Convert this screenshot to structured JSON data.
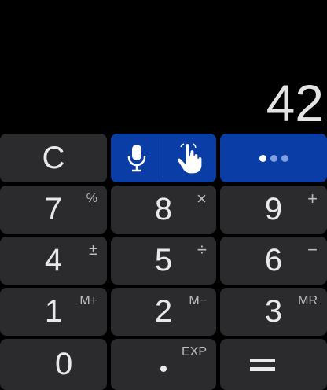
{
  "display": {
    "value": "42"
  },
  "keys": {
    "clear": "C",
    "row1": [
      {
        "main": "7",
        "sec": "%"
      },
      {
        "main": "8",
        "sec": "×"
      },
      {
        "main": "9",
        "sec": "+"
      }
    ],
    "row2": [
      {
        "main": "4",
        "sec": "±"
      },
      {
        "main": "5",
        "sec": "÷"
      },
      {
        "main": "6",
        "sec": "−"
      }
    ],
    "row3": [
      {
        "main": "1",
        "sec": "M+"
      },
      {
        "main": "2",
        "sec": "M−"
      },
      {
        "main": "3",
        "sec": "MR"
      }
    ],
    "row4": {
      "zero": "0",
      "decimal_sec": "EXP"
    }
  },
  "icons": {
    "mic": "microphone-icon",
    "hand": "touch-hand-icon",
    "more": "more-dots-icon"
  },
  "colors": {
    "background": "#000000",
    "key": "#2b2b2d",
    "accent": "#0a3da6"
  }
}
